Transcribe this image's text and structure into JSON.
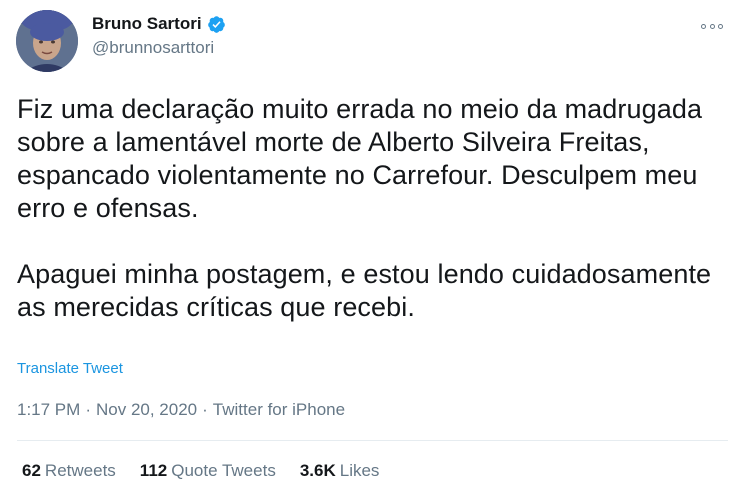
{
  "author": {
    "display_name": "Bruno Sartori",
    "handle": "@brunnosarttori",
    "verified": true,
    "verified_color": "#1da1f2"
  },
  "tweet": {
    "paragraphs": [
      "Fiz uma declaração muito errada no meio da madrugada sobre a lamentável morte de Alberto Silveira Freitas, espancado violentamente no Carrefour. Desculpem meu erro e ofensas.",
      "Apaguei minha postagem, e estou lendo cuidadosamente as merecidas críticas que recebi."
    ],
    "translate_label": "Translate Tweet"
  },
  "meta": {
    "time": "1:17 PM",
    "separator": "·",
    "date": "Nov 20, 2020",
    "source": "Twitter for iPhone"
  },
  "stats": [
    {
      "count": "62",
      "label": "Retweets"
    },
    {
      "count": "112",
      "label": "Quote Tweets"
    },
    {
      "count": "3.6K",
      "label": "Likes"
    }
  ],
  "colors": {
    "link": "#1b95e0",
    "secondary_text": "#657786",
    "primary_text": "#14171a"
  },
  "icons": {
    "more": "more-horizontal-icon",
    "verified": "verified-badge-icon"
  }
}
